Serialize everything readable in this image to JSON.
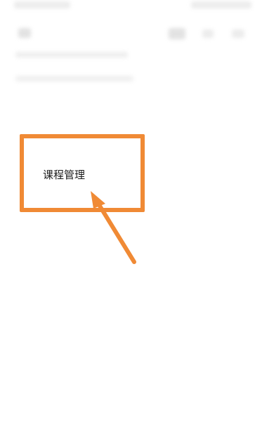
{
  "menu_item": {
    "label": "课程管理"
  },
  "annotation": {
    "color": "#f08a35",
    "shape": "rectangle-with-arrow"
  }
}
